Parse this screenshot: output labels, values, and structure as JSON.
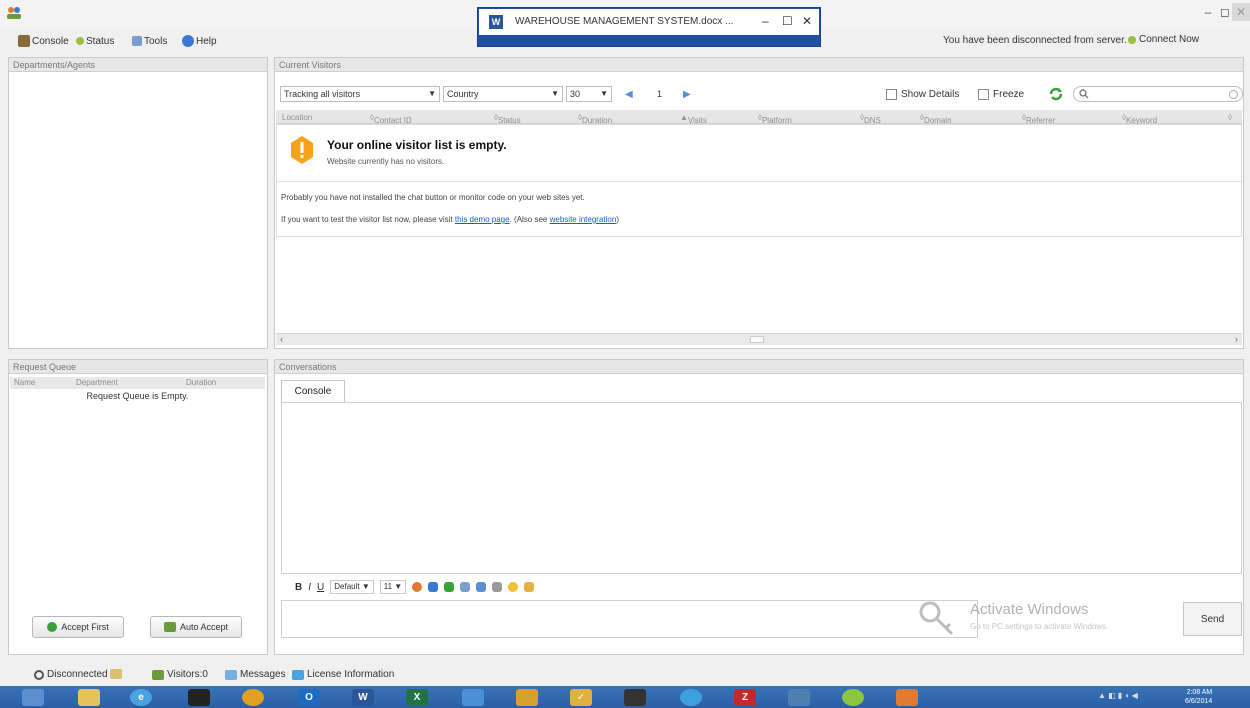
{
  "window": {
    "min_glyph": "–",
    "max_glyph": "◻",
    "close_glyph": "✕"
  },
  "floating_window": {
    "title": "WAREHOUSE MANAGEMENT SYSTEM.docx ...",
    "min_glyph": "–",
    "max_glyph": "☐",
    "close_glyph": "✕"
  },
  "menu": {
    "items": [
      {
        "label": "Console",
        "icon": "console-icon",
        "color": "#8a6a3b"
      },
      {
        "label": "Status",
        "icon": "status-icon",
        "color": "#9bbf3f"
      },
      {
        "label": "Tools",
        "icon": "tools-icon",
        "color": "#7a9ccf"
      },
      {
        "label": "Help",
        "icon": "help-icon",
        "color": "#3a78d6"
      }
    ],
    "disconnected_message": "You have been disconnected from server.",
    "connect_now": "Connect Now"
  },
  "departments_panel": {
    "header": "Departments/Agents"
  },
  "visitors_panel": {
    "header": "Current Visitors",
    "tracking_select": "Tracking all visitors",
    "country_select": "Country",
    "page_size": "30",
    "page_number": "1",
    "show_details_label": "Show Details",
    "freeze_label": "Freeze",
    "columns": [
      "Location",
      "Contact ID",
      "Status",
      "Duration",
      "Visits",
      "Platform",
      "DNS",
      "Domain",
      "Referrer",
      "Keyword"
    ],
    "empty_title": "Your online visitor list is empty.",
    "empty_subtitle": "Website currently has no visitors.",
    "hint1": "Probably you have not installed the chat button or monitor code on your web sites yet.",
    "hint2_prefix": "If you want to test the visitor list now, please visit",
    "hint2_link": "this demo page",
    "hint2_middle": ". (Also see",
    "hint2_link2": "website integration",
    "hint2_suffix": ")"
  },
  "request_queue": {
    "header": "Request Queue",
    "columns": [
      "Name",
      "Department",
      "Duration"
    ],
    "empty": "Request Queue is Empty.",
    "accept_first": "Accept First",
    "auto_accept": "Auto Accept"
  },
  "conversations": {
    "header": "Conversations",
    "tab": "Console",
    "format": {
      "bold": "B",
      "italic": "I",
      "underline": "U",
      "font": "Default",
      "size": "11"
    },
    "watermark_title": "Activate Windows",
    "watermark_sub": "Go to PC settings to activate Windows.",
    "send": "Send"
  },
  "statusbar": {
    "connection": "Disconnected",
    "visitors": "Visitors:0",
    "messages": "Messages",
    "license": "License Information"
  },
  "taskbar": {
    "time": "2:08 AM",
    "date": "6/6/2014",
    "icons": [
      {
        "name": "desktop-icon",
        "color": "#5b8fd0"
      },
      {
        "name": "file-explorer-icon",
        "color": "#e6c35a"
      },
      {
        "name": "internet-explorer-icon",
        "color": "#4aa3e0"
      },
      {
        "name": "command-prompt-icon",
        "color": "#222222"
      },
      {
        "name": "chrome-icon",
        "color": "#e0a020"
      },
      {
        "name": "outlook-icon",
        "color": "#1f6bc1"
      },
      {
        "name": "word-icon",
        "color": "#2b579a"
      },
      {
        "name": "excel-icon",
        "color": "#217346"
      },
      {
        "name": "network-tool-icon",
        "color": "#4a8fd8"
      },
      {
        "name": "paint-icon",
        "color": "#d8a030"
      },
      {
        "name": "checkmark-app-icon",
        "color": "#e0b040"
      },
      {
        "name": "terminal-icon",
        "color": "#333333"
      },
      {
        "name": "cortana-icon",
        "color": "#3ba0e0"
      },
      {
        "name": "filezilla-icon",
        "color": "#bf2b2b"
      },
      {
        "name": "remote-desktop-icon",
        "color": "#4f7fb0"
      },
      {
        "name": "refresh-app-icon",
        "color": "#8cc63f"
      },
      {
        "name": "live-chat-app-icon",
        "color": "#e07a30"
      }
    ]
  }
}
